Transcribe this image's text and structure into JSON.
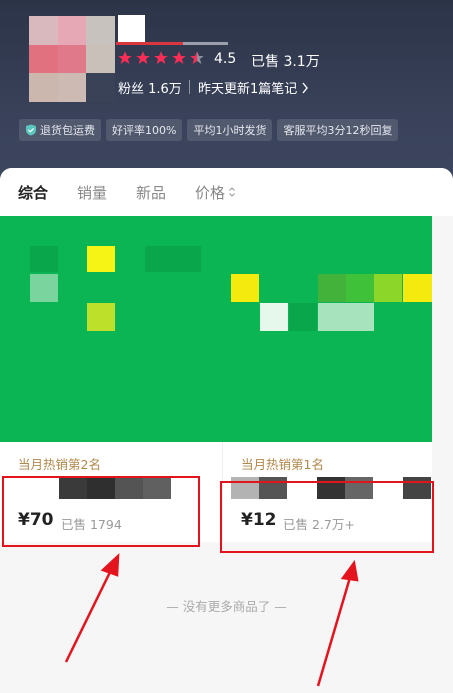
{
  "shop": {
    "rating": "4.5",
    "sold": "已售 3.1万",
    "fans": "粉丝 1.6万",
    "update": "昨天更新1篇笔记",
    "stars_filled": 4.5,
    "tags": [
      "退货包运费",
      "好评率100%",
      "平均1小时发货",
      "客服平均3分12秒回复"
    ]
  },
  "tabs": [
    "综合",
    "销量",
    "新品",
    "价格"
  ],
  "products": [
    {
      "rank": "当月热销第2名",
      "price": "¥70",
      "sold": "已售 1794"
    },
    {
      "rank": "当月热销第1名",
      "price": "¥12",
      "sold": "已售 2.7万+"
    }
  ],
  "footer": {
    "end_text": "— 没有更多商品了 —"
  },
  "colors": {
    "accent_red": "#e3141e",
    "star": "#ff2d55",
    "gold": "#b2874a",
    "banner_green": "#0bb554"
  }
}
